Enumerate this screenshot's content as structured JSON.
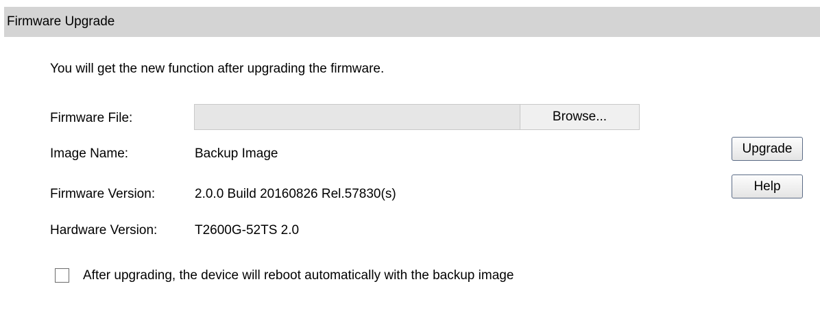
{
  "panel": {
    "title": "Firmware Upgrade"
  },
  "intro": "You will get the new function after upgrading the firmware.",
  "firmware_file": {
    "label": "Firmware File:",
    "value": "",
    "browse_label": "Browse..."
  },
  "image_name": {
    "label": "Image Name:",
    "value": "Backup Image"
  },
  "firmware_version": {
    "label": "Firmware Version:",
    "value": "2.0.0 Build 20160826 Rel.57830(s)"
  },
  "hardware_version": {
    "label": "Hardware Version:",
    "value": "T2600G-52TS 2.0"
  },
  "buttons": {
    "upgrade": "Upgrade",
    "help": "Help"
  },
  "reboot_option": {
    "checked": false,
    "label": "After upgrading, the device will reboot automatically with the backup image"
  }
}
